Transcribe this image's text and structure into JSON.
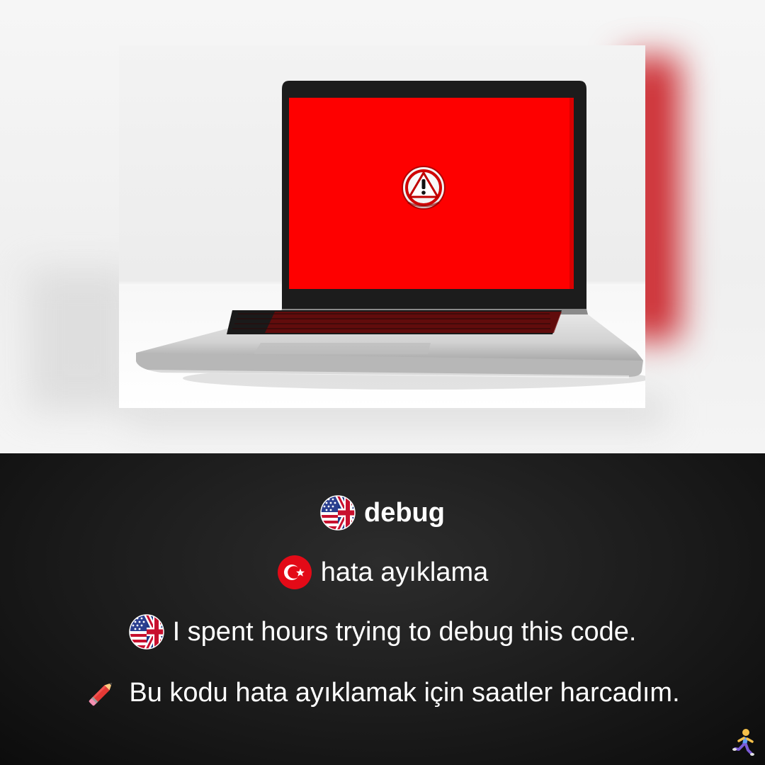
{
  "photo": {
    "subject": "laptop-warning-icon",
    "screen_color": "#fe0000"
  },
  "lines": {
    "word_en": "debug",
    "word_tr": "hata ayıklama",
    "sentence_en": "I spent hours trying to debug this code.",
    "sentence_tr": "Bu kodu hata ayıklamak için saatler harcadım."
  },
  "icons": {
    "line1": "us-uk-flag-icon",
    "line2": "turkey-flag-icon",
    "line3": "us-uk-flag-icon",
    "line4": "pencil-icon",
    "corner": "running-person-icon"
  },
  "colors": {
    "panel_bg": "#1b1b1b",
    "text": "#ffffff",
    "turkey_red": "#e30a17"
  }
}
